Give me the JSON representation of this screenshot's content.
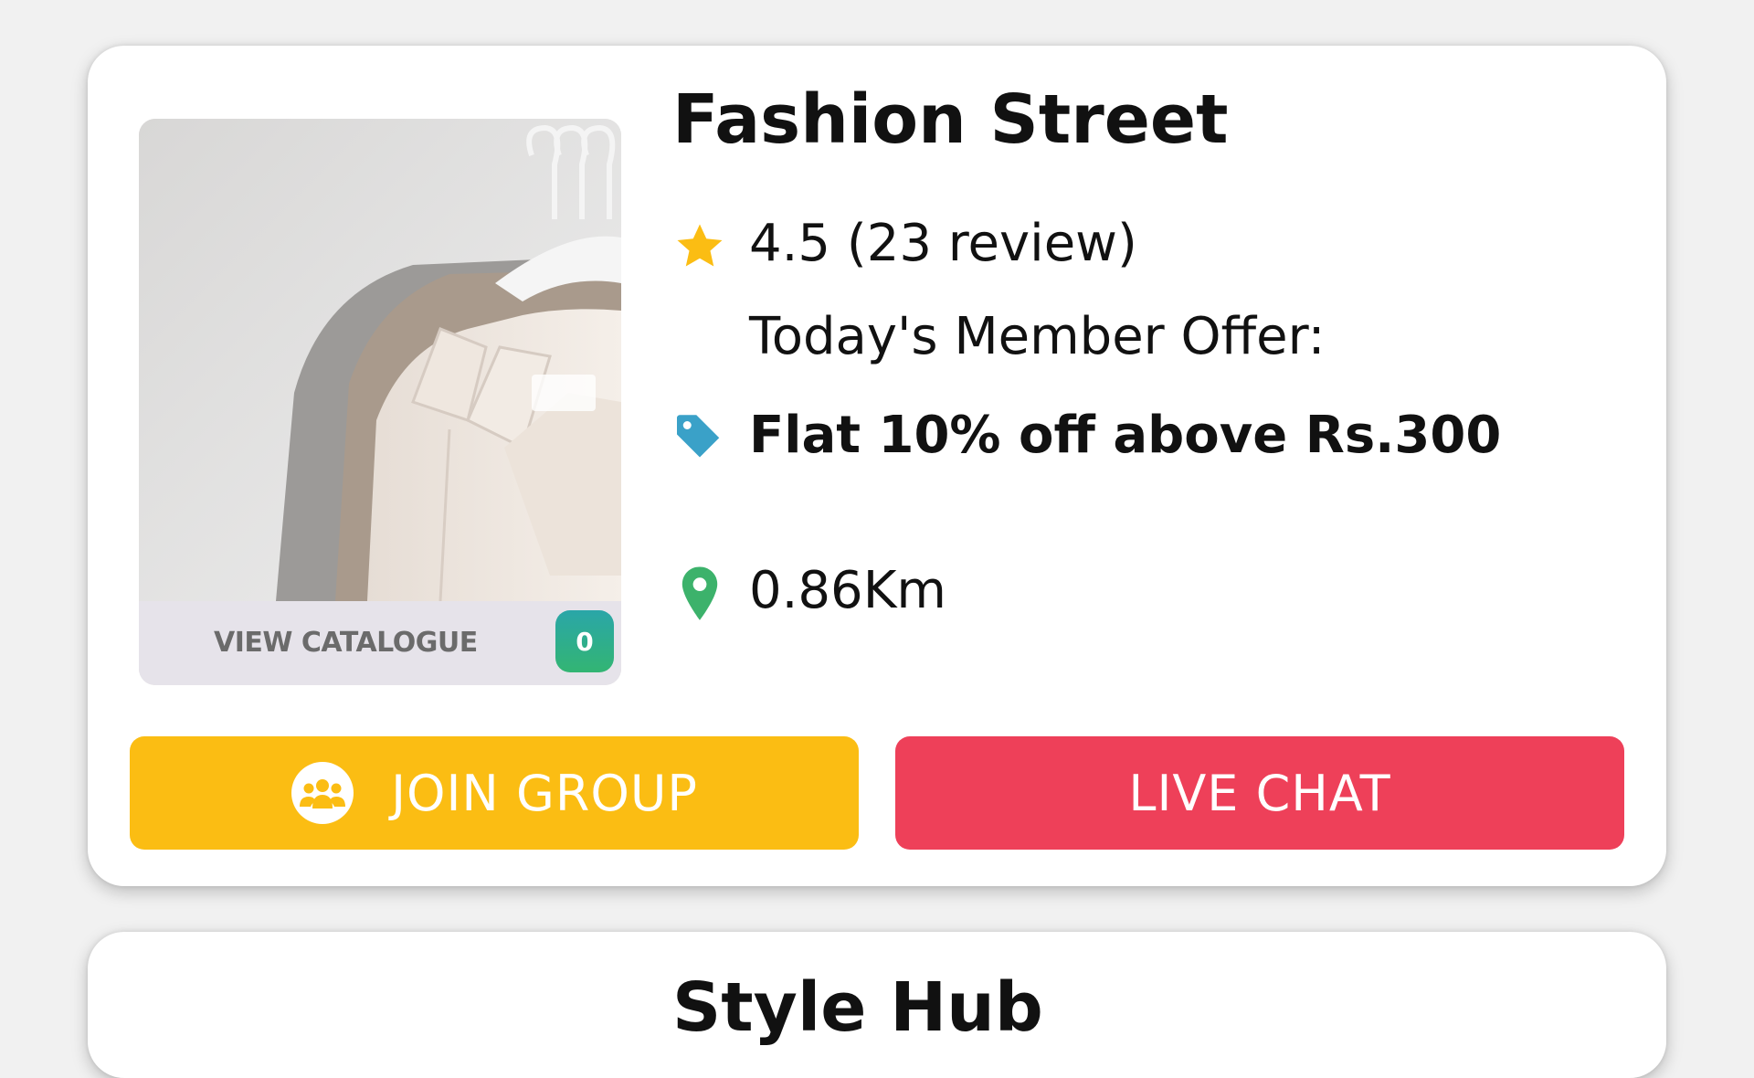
{
  "store": {
    "name": "Fashion Street",
    "rating_text": "4.5 (23 review)",
    "offer_label": "Today's Member Offer:",
    "offer_value": "Flat 10% off above Rs.300",
    "distance": "0.86Km",
    "catalogue": {
      "label": "VIEW CATALOGUE",
      "count": "0"
    },
    "buttons": {
      "join": "JOIN GROUP",
      "chat": "LIVE CHAT"
    }
  },
  "next_store": {
    "name": "Style Hub"
  },
  "icons": {
    "rating": "star-icon",
    "offer": "tag-icon",
    "distance": "map-pin-icon",
    "join": "group-icon"
  },
  "colors": {
    "star": "#fbbd13",
    "tag": "#3aa1c8",
    "pin": "#3cb26b",
    "join_button": "#fbbd13",
    "chat_button": "#ee4059",
    "badge": "#2fae8a"
  }
}
